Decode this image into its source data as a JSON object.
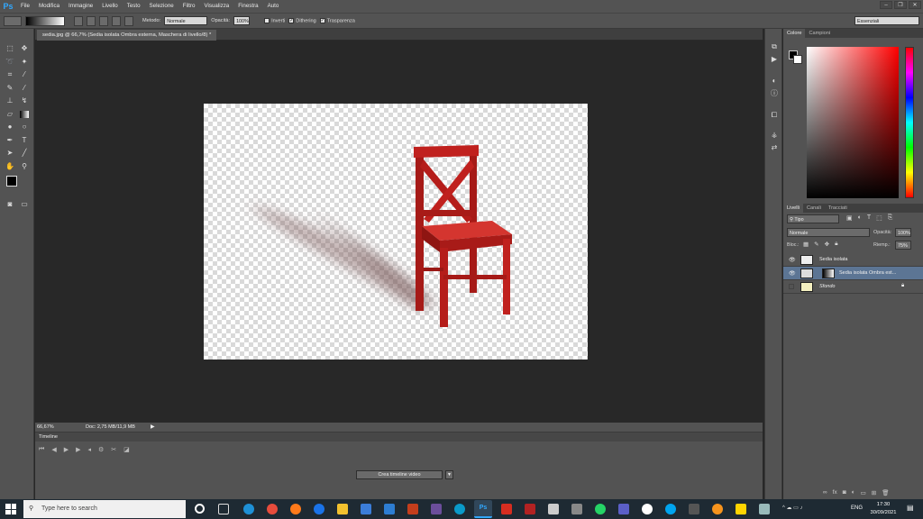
{
  "app": {
    "logo": "Ps"
  },
  "menu": [
    "File",
    "Modifica",
    "Immagine",
    "Livello",
    "Testo",
    "Selezione",
    "Filtro",
    "Visualizza",
    "Finestra",
    "Auto"
  ],
  "options": {
    "metodo_label": "Metodo:",
    "metodo_value": "Normale",
    "opacita_label": "Opacità:",
    "opacita_value": "100%",
    "inverti": "Inverti",
    "dithering": "Dithering",
    "trasparenza": "Trasparenza",
    "workspace": "Essenziali"
  },
  "document": {
    "tab": "sedia.jpg @ 66,7% (Sedia isolata Ombra esterna, Maschera di livello/8) *",
    "zoom": "66,67%",
    "doc_info": "Doc: 2,75 MB/11,9 MB"
  },
  "timeline": {
    "title": "Timeline",
    "create_button": "Crea timeline video"
  },
  "color_panel": {
    "tabs": [
      "Colore",
      "Campioni"
    ]
  },
  "layers_panel": {
    "tabs": [
      "Livelli",
      "Canali",
      "Tracciati"
    ],
    "filter": "Tipo",
    "blend_mode": "Normale",
    "opacity_label": "Opacità:",
    "opacity_value": "100%",
    "lock_label": "Bloc.:",
    "fill_label": "Riemp.:",
    "fill_value": "75%",
    "layers": [
      {
        "name": "Sedia isolata",
        "visible": true,
        "selected": false
      },
      {
        "name": "Sedia isolata Ombra est...",
        "visible": true,
        "selected": true
      },
      {
        "name": "Sfondo",
        "visible": false,
        "selected": false
      }
    ]
  },
  "taskbar": {
    "search_placeholder": "Type here to search",
    "lang": "ENG",
    "time": "17:30",
    "date": "30/09/2021"
  },
  "colors": {
    "accent": "#31a8ff",
    "chair": "#c0211e",
    "selection": "#5c7594"
  }
}
